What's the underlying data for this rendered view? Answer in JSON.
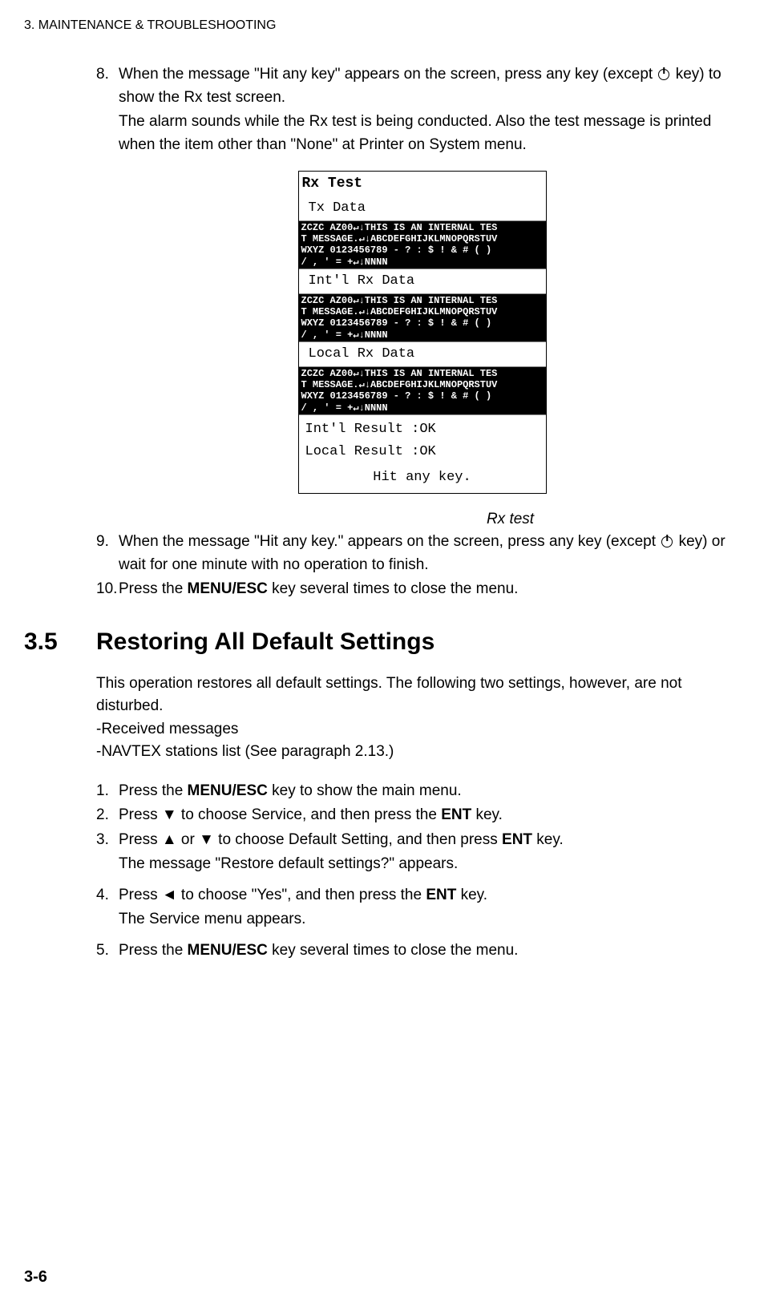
{
  "header": "3. MAINTENANCE & TROUBLESHOOTING",
  "step8": {
    "num": "8.",
    "line1a": "When the message \"Hit any key\" appears on the screen, press any key (except ",
    "line1b": " key) to show the Rx test screen.",
    "sub": "The alarm sounds while the Rx test is being conducted. Also the test message is printed when the item other than \"None\" at Printer on System menu."
  },
  "figure": {
    "title": "Rx Test",
    "txData": "Tx Data",
    "dataBlock": "ZCZC AZ00↵↓THIS IS AN INTERNAL TES\nT MESSAGE.↵↓ABCDEFGHIJKLMNOPQRSTUV\nWXYZ 0123456789 - ? : $ ! & # ( )\n/ , ' = +↵↓NNNN",
    "intlRxData": "Int'l Rx Data",
    "localRxData": "Local Rx Data",
    "intlResult": "Int'l Result :OK",
    "localResult": "Local Result :OK",
    "hitKey": "Hit any key.",
    "caption": "Rx test"
  },
  "step9": {
    "num": "9.",
    "line1a": "When the message \"Hit any key.\" appears on the screen, press any key (except ",
    "line1b": " key) or wait for one minute with no operation to finish."
  },
  "step10": {
    "num": "10.",
    "text_a": "Press the ",
    "text_b": "MENU/ESC",
    "text_c": " key several times to close the menu."
  },
  "section": {
    "num": "3.5",
    "title": "Restoring All Default Settings"
  },
  "intro": {
    "p1": "This operation restores all default settings. The following two settings, however, are not disturbed.",
    "p2": "-Received messages",
    "p3": "-NAVTEX stations list (See paragraph 2.13.)"
  },
  "s1": {
    "num": "1.",
    "a": "Press the ",
    "b": "MENU/ESC",
    "c": " key to show the main menu."
  },
  "s2": {
    "num": "2.",
    "a": "Press ▼ to choose Service, and then press the ",
    "b": "ENT",
    "c": " key."
  },
  "s3": {
    "num": "3.",
    "a": "Press ▲ or ▼ to choose Default Setting, and then press ",
    "b": "ENT",
    "c": " key.",
    "sub": "The message \"Restore default settings?\" appears."
  },
  "s4": {
    "num": "4.",
    "a": "Press ◄ to choose \"Yes\", and then press the ",
    "b": "ENT",
    "c": " key.",
    "sub": "The Service menu appears."
  },
  "s5": {
    "num": "5.",
    "a": "Press the ",
    "b": "MENU/ESC",
    "c": " key several times to close the menu."
  },
  "pageNum": "3-6"
}
